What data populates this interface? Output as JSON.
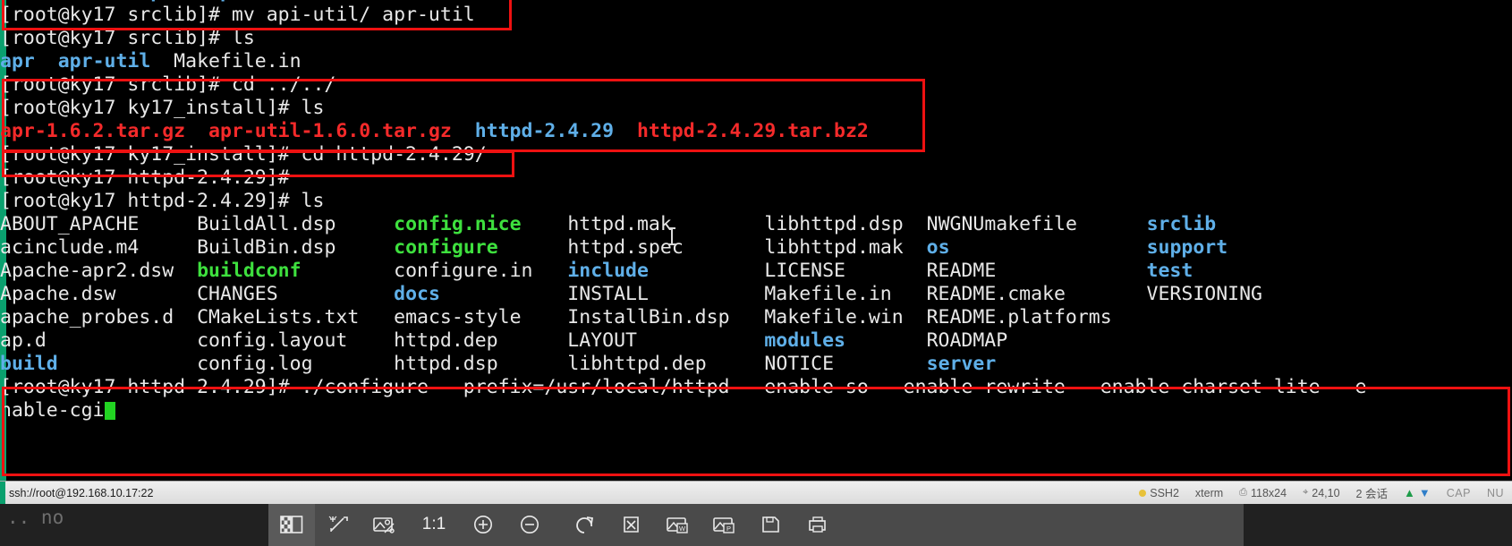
{
  "terminal": {
    "lines": [
      {
        "id": "line-0-clipped",
        "segments": [
          {
            "text": "            ",
            "color": "white"
          },
          {
            "text": "apr",
            "color": "blue"
          },
          {
            "text": "   ",
            "color": "white"
          },
          {
            "text": "apr-util",
            "color": "blue"
          },
          {
            "text": "   Makefile.in",
            "color": "white"
          }
        ]
      },
      {
        "id": "line-mv",
        "segments": [
          {
            "text": "[root@ky17 srclib]# mv api-util/ apr-util",
            "color": "white"
          }
        ]
      },
      {
        "id": "line-ls-srclib",
        "segments": [
          {
            "text": "[root@ky17 srclib]# ls",
            "color": "white"
          }
        ]
      },
      {
        "id": "line-srclib-out",
        "segments": [
          {
            "text": "apr",
            "color": "blue"
          },
          {
            "text": "  ",
            "color": "white"
          },
          {
            "text": "apr-util",
            "color": "blue"
          },
          {
            "text": "  Makefile.in",
            "color": "white"
          }
        ]
      },
      {
        "id": "line-cd-up",
        "segments": [
          {
            "text": "[root@ky17 srclib]# cd ../../",
            "color": "white"
          }
        ]
      },
      {
        "id": "line-ls-install",
        "segments": [
          {
            "text": "[root@ky17 ky17_install]# ls",
            "color": "white"
          }
        ]
      },
      {
        "id": "line-install-out",
        "segments": [
          {
            "text": "apr-1.6.2.tar.gz",
            "color": "red"
          },
          {
            "text": "  ",
            "color": "white"
          },
          {
            "text": "apr-util-1.6.0.tar.gz",
            "color": "red"
          },
          {
            "text": "  ",
            "color": "white"
          },
          {
            "text": "httpd-2.4.29",
            "color": "blue"
          },
          {
            "text": "  ",
            "color": "white"
          },
          {
            "text": "httpd-2.4.29.tar.bz2",
            "color": "red"
          }
        ]
      },
      {
        "id": "line-cd-httpd",
        "segments": [
          {
            "text": "[root@ky17 ky17_install]# cd httpd-2.4.29/",
            "color": "white"
          }
        ]
      },
      {
        "id": "line-prompt-empty",
        "segments": [
          {
            "text": "[root@ky17 httpd-2.4.29]#",
            "color": "white"
          }
        ]
      },
      {
        "id": "line-ls-httpd",
        "segments": [
          {
            "text": "[root@ky17 httpd-2.4.29]# ls",
            "color": "white"
          }
        ]
      }
    ],
    "ls_columns": [
      {
        "id": "col-1",
        "entries": [
          {
            "name": "ABOUT_APACHE",
            "color": "white"
          },
          {
            "name": "acinclude.m4",
            "color": "white"
          },
          {
            "name": "Apache-apr2.dsw",
            "color": "white"
          },
          {
            "name": "Apache.dsw",
            "color": "white"
          },
          {
            "name": "apache_probes.d",
            "color": "white"
          },
          {
            "name": "ap.d",
            "color": "white"
          },
          {
            "name": "build",
            "color": "blue"
          }
        ]
      },
      {
        "id": "col-2",
        "entries": [
          {
            "name": "BuildAll.dsp",
            "color": "white"
          },
          {
            "name": "BuildBin.dsp",
            "color": "white"
          },
          {
            "name": "buildconf",
            "color": "green"
          },
          {
            "name": "CHANGES",
            "color": "white"
          },
          {
            "name": "CMakeLists.txt",
            "color": "white"
          },
          {
            "name": "config.layout",
            "color": "white"
          },
          {
            "name": "config.log",
            "color": "white"
          }
        ]
      },
      {
        "id": "col-3",
        "entries": [
          {
            "name": "config.nice",
            "color": "green"
          },
          {
            "name": "configure",
            "color": "green"
          },
          {
            "name": "configure.in",
            "color": "white"
          },
          {
            "name": "docs",
            "color": "blue"
          },
          {
            "name": "emacs-style",
            "color": "white"
          },
          {
            "name": "httpd.dep",
            "color": "white"
          },
          {
            "name": "httpd.dsp",
            "color": "white"
          }
        ]
      },
      {
        "id": "col-4",
        "entries": [
          {
            "name": "httpd.mak",
            "color": "white"
          },
          {
            "name": "httpd.spec",
            "color": "white"
          },
          {
            "name": "include",
            "color": "blue"
          },
          {
            "name": "INSTALL",
            "color": "white"
          },
          {
            "name": "InstallBin.dsp",
            "color": "white"
          },
          {
            "name": "LAYOUT",
            "color": "white"
          },
          {
            "name": "libhttpd.dep",
            "color": "white"
          }
        ]
      },
      {
        "id": "col-5",
        "entries": [
          {
            "name": "libhttpd.dsp",
            "color": "white"
          },
          {
            "name": "libhttpd.mak",
            "color": "white"
          },
          {
            "name": "LICENSE",
            "color": "white"
          },
          {
            "name": "Makefile.in",
            "color": "white"
          },
          {
            "name": "Makefile.win",
            "color": "white"
          },
          {
            "name": "modules",
            "color": "blue"
          },
          {
            "name": "NOTICE",
            "color": "white"
          }
        ]
      },
      {
        "id": "col-6",
        "entries": [
          {
            "name": "NWGNUmakefile",
            "color": "white"
          },
          {
            "name": "os",
            "color": "blue"
          },
          {
            "name": "README",
            "color": "white"
          },
          {
            "name": "README.cmake",
            "color": "white"
          },
          {
            "name": "README.platforms",
            "color": "white"
          },
          {
            "name": "ROADMAP",
            "color": "white"
          },
          {
            "name": "server",
            "color": "blue"
          }
        ]
      },
      {
        "id": "col-7",
        "entries": [
          {
            "name": "srclib",
            "color": "blue"
          },
          {
            "name": "support",
            "color": "blue"
          },
          {
            "name": "test",
            "color": "blue"
          },
          {
            "name": "VERSIONING",
            "color": "white"
          },
          {
            "name": "",
            "color": "white"
          },
          {
            "name": "",
            "color": "white"
          },
          {
            "name": "",
            "color": "white"
          }
        ]
      }
    ],
    "configure_line_1": "[root@ky17 httpd-2.4.29]# ./configure --prefix=/usr/local/httpd --enable-so --enable-rewrite --enable-charset-lite --e",
    "configure_line_2": "nable-cgi",
    "annotation_color": "#ee1111",
    "colors": {
      "background": "#000000",
      "foreground": "#e8e8e8",
      "directory_blue": "#5fafe8",
      "executable_green": "#3ee03e",
      "archive_red": "#f42a2a",
      "cursor_green": "#22d422",
      "accent_teal": "#0aa06e"
    }
  },
  "statusbar": {
    "path": "ssh://root@192.168.10.17:22",
    "protocol": "SSH2",
    "emulation": "xterm",
    "size_icon": "screen-size-icon",
    "size": "118x24",
    "cursor_icon": "cursor-position-icon",
    "cursor_position": "24,10",
    "sessions": "2 会话",
    "upload_icon": "arrow-up-icon",
    "download_icon": "arrow-down-icon",
    "caps": "CAP",
    "num": "NU"
  },
  "viewer": {
    "background_text": ".. no",
    "zoom_ratio": "1:1",
    "buttons": [
      {
        "id": "tb-transparency",
        "icon": "checkerboard-transparency-icon",
        "label": ""
      },
      {
        "id": "tb-effects",
        "icon": "magic-wand-icon",
        "label": ""
      },
      {
        "id": "tb-resize",
        "icon": "image-percent-icon",
        "label": ""
      },
      {
        "id": "tb-actual-size",
        "icon": "ratio-label",
        "label": "1:1"
      },
      {
        "id": "tb-zoom-in",
        "icon": "zoom-in-icon",
        "label": ""
      },
      {
        "id": "tb-zoom-out",
        "icon": "zoom-out-icon",
        "label": ""
      },
      {
        "id": "tb-rotate",
        "icon": "rotate-cw-icon",
        "label": ""
      },
      {
        "id": "tb-delete",
        "icon": "delete-x-icon",
        "label": ""
      },
      {
        "id": "tb-word",
        "icon": "image-to-word-icon",
        "label": ""
      },
      {
        "id": "tb-pdf",
        "icon": "image-to-pdf-icon",
        "label": ""
      },
      {
        "id": "tb-save",
        "icon": "save-floppy-icon",
        "label": ""
      },
      {
        "id": "tb-print",
        "icon": "print-icon",
        "label": ""
      }
    ]
  }
}
